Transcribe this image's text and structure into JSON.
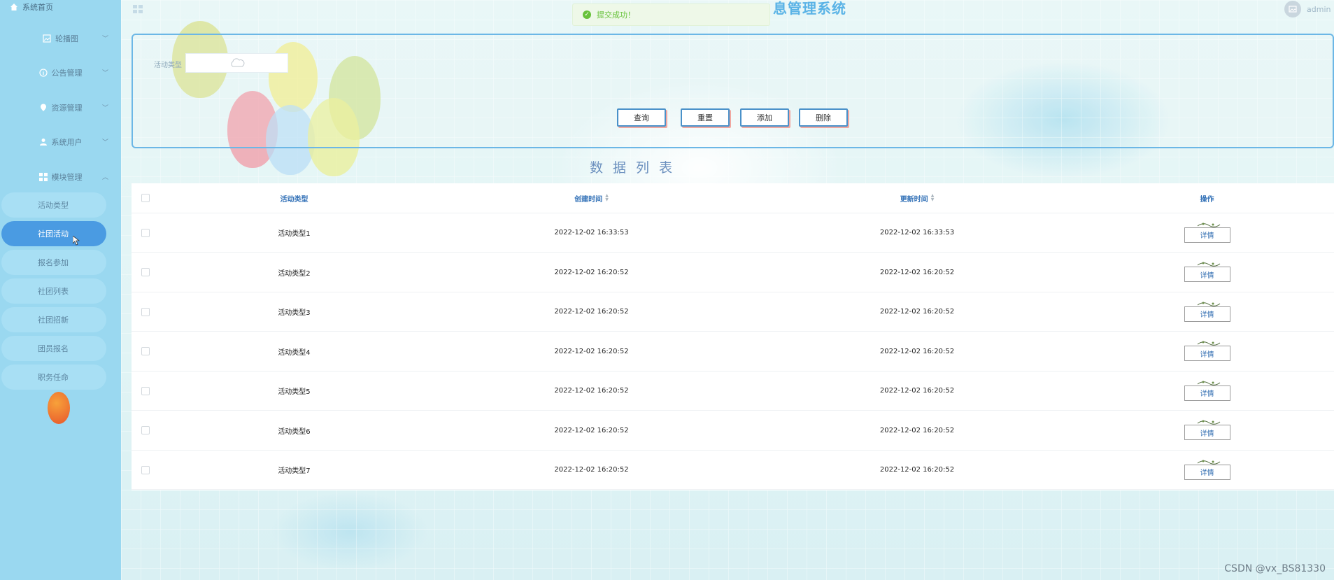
{
  "header": {
    "title": "息管理系统",
    "user": "admin",
    "toast": "提交成功！"
  },
  "sidebar": {
    "home": "系统首页",
    "groups": [
      {
        "label": "轮播图",
        "icon": "picture-icon"
      },
      {
        "label": "公告管理",
        "icon": "info-circle-icon"
      },
      {
        "label": "资源管理",
        "icon": "location-icon"
      },
      {
        "label": "系统用户",
        "icon": "user-icon"
      },
      {
        "label": "模块管理",
        "icon": "grid-icon"
      }
    ],
    "items": [
      {
        "label": "活动类型",
        "active": false
      },
      {
        "label": "社团活动",
        "active": true
      },
      {
        "label": "报名参加",
        "active": false
      },
      {
        "label": "社团列表",
        "active": false
      },
      {
        "label": "社团招新",
        "active": false
      },
      {
        "label": "团员报名",
        "active": false
      },
      {
        "label": "职务任命",
        "active": false
      }
    ]
  },
  "search": {
    "field_label": "活动类型",
    "field_value": "",
    "buttons": [
      "查询",
      "重置",
      "添加",
      "删除"
    ]
  },
  "list_title": "数据列表",
  "table": {
    "columns": [
      "活动类型",
      "创建时间",
      "更新时间",
      "操作"
    ],
    "detail_label": "详情",
    "rows": [
      {
        "type": "活动类型1",
        "created": "2022-12-02 16:33:53",
        "updated": "2022-12-02 16:33:53"
      },
      {
        "type": "活动类型2",
        "created": "2022-12-02 16:20:52",
        "updated": "2022-12-02 16:20:52"
      },
      {
        "type": "活动类型3",
        "created": "2022-12-02 16:20:52",
        "updated": "2022-12-02 16:20:52"
      },
      {
        "type": "活动类型4",
        "created": "2022-12-02 16:20:52",
        "updated": "2022-12-02 16:20:52"
      },
      {
        "type": "活动类型5",
        "created": "2022-12-02 16:20:52",
        "updated": "2022-12-02 16:20:52"
      },
      {
        "type": "活动类型6",
        "created": "2022-12-02 16:20:52",
        "updated": "2022-12-02 16:20:52"
      },
      {
        "type": "活动类型7",
        "created": "2022-12-02 16:20:52",
        "updated": "2022-12-02 16:20:52"
      }
    ]
  },
  "watermark": "CSDN @vx_BS81330",
  "colors": {
    "sidebar_bg": "#9ad8f0",
    "sidebar_active": "#4a9be2",
    "accent": "#4a91c9",
    "header_title": "#5ab3e6",
    "success": "#67c23a"
  }
}
